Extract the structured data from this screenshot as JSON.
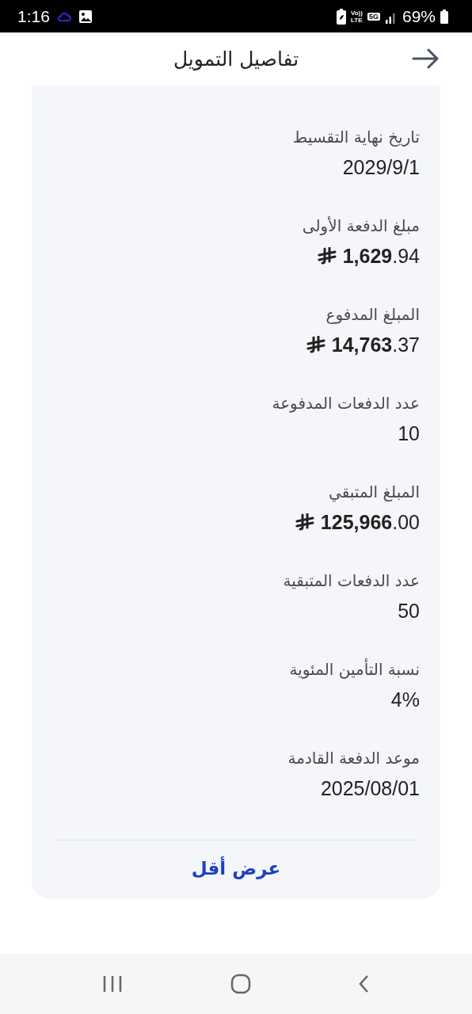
{
  "status_bar": {
    "time": "1:16",
    "volte_top": "Vo))",
    "volte_bottom": "LTE",
    "network": "5G",
    "battery": "69%"
  },
  "header": {
    "title": "تفاصيل التمويل"
  },
  "details": [
    {
      "kind": "plain",
      "label": "تاريخ نهاية التقسيط",
      "value": "2029/9/1"
    },
    {
      "kind": "amount",
      "label": "مبلغ الدفعة الأولى",
      "value": "**1,629**.94"
    },
    {
      "kind": "amount",
      "label": "المبلغ المدفوع",
      "value": "**14,763**.37"
    },
    {
      "kind": "plain",
      "label": "عدد الدفعات المدفوعة",
      "value": "10"
    },
    {
      "kind": "amount",
      "label": "المبلغ المتبقي",
      "value": "**125,966**.00"
    },
    {
      "kind": "plain",
      "label": "عدد الدفعات المتبقية",
      "value": "50"
    },
    {
      "kind": "plain",
      "label": "نسبة التأمين المئوية",
      "value": "4%"
    },
    {
      "kind": "plain",
      "label": "موعد الدفعة القادمة",
      "value": "2025/08/01"
    }
  ],
  "show_less": "عرض أقل"
}
